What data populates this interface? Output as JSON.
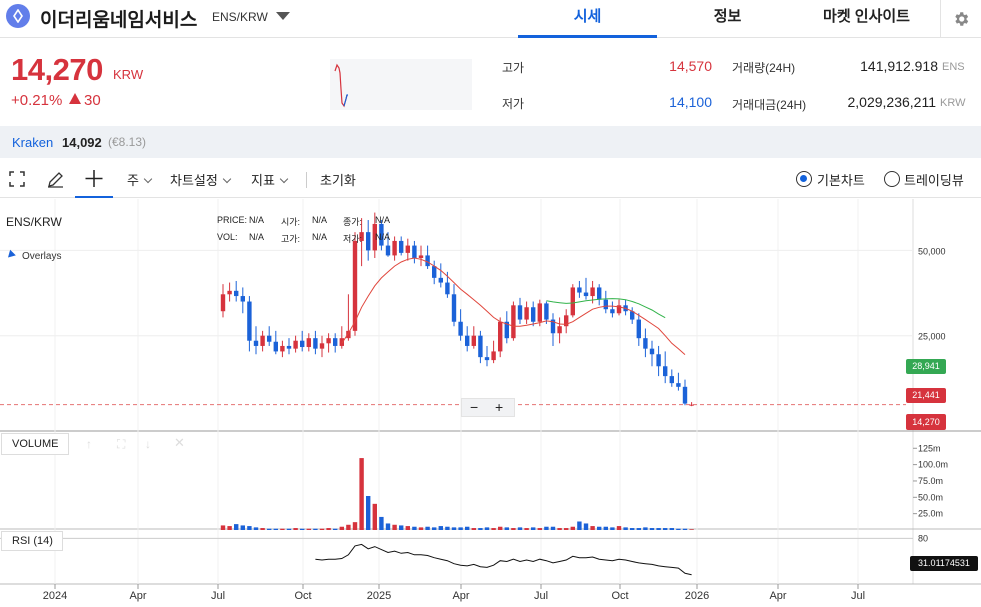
{
  "header": {
    "coin_name": "이더리움네임서비스",
    "pair": "ENS/KRW",
    "tabs": [
      "시세",
      "정보",
      "마켓 인사이트"
    ],
    "active_tab": "시세",
    "accent": "#1362dc"
  },
  "price": {
    "value": "14,270",
    "unit": "KRW",
    "change_pct": "+0.21%",
    "change_amount": "30",
    "direction": "up",
    "color": "#d6333d"
  },
  "stats": {
    "high_label": "고가",
    "high_value": "14,570",
    "low_label": "저가",
    "low_value": "14,100",
    "volume_label": "거래량(24H)",
    "volume_value": "141,912.918",
    "volume_unit": "ENS",
    "amount_label": "거래대금(24H)",
    "amount_value": "2,029,236,211",
    "amount_unit": "KRW"
  },
  "exchange": {
    "name": "Kraken",
    "price": "14,092",
    "fiat": "(€8.13)"
  },
  "toolbar": {
    "fullscreen_icon": "fullscreen-icon",
    "pencil_icon": "pencil-icon",
    "crosshair_icon": "crosshair-icon",
    "period_label": "주",
    "settings_label": "차트설정",
    "indicator_label": "지표",
    "reset_label": "초기화",
    "basic_chart_label": "기본차트",
    "tradingview_label": "트레이딩뷰",
    "selected_view": "기본차트"
  },
  "chart_panel": {
    "symbol": "ENS/KRW",
    "overlays_label": "Overlays",
    "ohlc_labels": {
      "price": "PRICE:",
      "open": "시가:",
      "close": "종가:",
      "vol": "VOL:",
      "high": "고가:",
      "low": "저가:"
    },
    "ohlc_value": "N/A",
    "zoom_out": "−",
    "zoom_in": "+",
    "volume_label": "VOLUME",
    "rsi_label": "RSI (14)",
    "y_ticks": [
      "50,000",
      "25,000"
    ],
    "vol_ticks": [
      "125m",
      "100.0m",
      "75.0m",
      "50.0m",
      "25.0m"
    ],
    "rsi_ticks": [
      "80"
    ],
    "x_ticks": [
      "2024",
      "Apr",
      "Jul",
      "Oct",
      "2025",
      "Apr",
      "Jul",
      "Oct",
      "2026",
      "Apr",
      "Jul"
    ],
    "price_tag": "14,270",
    "ma_long_tag": "28,941",
    "ma_short_tag": "21,441",
    "rsi_value": "31.01174531",
    "up_color": "#d6333d",
    "down_color": "#1b62d8",
    "ma_short_color": "#e0463c",
    "ma_long_color": "#32b34a"
  },
  "chart_data": {
    "type": "candlestick",
    "title": "ENS/KRW",
    "interval": "weekly",
    "x_start": "2024-07",
    "x_end": "2025-12",
    "candles": [
      {
        "o": 30500,
        "h": 38000,
        "l": 29000,
        "c": 35000
      },
      {
        "o": 35000,
        "h": 38500,
        "l": 33000,
        "c": 36000
      },
      {
        "o": 36000,
        "h": 39000,
        "l": 33000,
        "c": 34500
      },
      {
        "o": 34500,
        "h": 37000,
        "l": 30000,
        "c": 33000
      },
      {
        "o": 33000,
        "h": 34500,
        "l": 22000,
        "c": 24000
      },
      {
        "o": 24000,
        "h": 27000,
        "l": 21500,
        "c": 23000
      },
      {
        "o": 23000,
        "h": 26000,
        "l": 22000,
        "c": 25000
      },
      {
        "o": 25000,
        "h": 27000,
        "l": 23000,
        "c": 23800
      },
      {
        "o": 23800,
        "h": 26000,
        "l": 21500,
        "c": 22000
      },
      {
        "o": 22000,
        "h": 24000,
        "l": 21000,
        "c": 23000
      },
      {
        "o": 23000,
        "h": 24500,
        "l": 21500,
        "c": 22500
      },
      {
        "o": 22500,
        "h": 25000,
        "l": 21800,
        "c": 24000
      },
      {
        "o": 24000,
        "h": 26000,
        "l": 22000,
        "c": 22800
      },
      {
        "o": 22800,
        "h": 25500,
        "l": 22000,
        "c": 24500
      },
      {
        "o": 24500,
        "h": 26000,
        "l": 21500,
        "c": 22500
      },
      {
        "o": 22500,
        "h": 25000,
        "l": 21000,
        "c": 23500
      },
      {
        "o": 23500,
        "h": 25500,
        "l": 21800,
        "c": 24500
      },
      {
        "o": 24500,
        "h": 25500,
        "l": 21800,
        "c": 23000
      },
      {
        "o": 23000,
        "h": 27000,
        "l": 22500,
        "c": 24500
      },
      {
        "o": 24500,
        "h": 35000,
        "l": 24000,
        "c": 26000
      },
      {
        "o": 26000,
        "h": 58000,
        "l": 25000,
        "c": 54000
      },
      {
        "o": 54000,
        "h": 65000,
        "l": 44000,
        "c": 58000
      },
      {
        "o": 58000,
        "h": 64000,
        "l": 46000,
        "c": 50000
      },
      {
        "o": 50000,
        "h": 68000,
        "l": 47000,
        "c": 62000
      },
      {
        "o": 62000,
        "h": 64000,
        "l": 50000,
        "c": 52000
      },
      {
        "o": 52000,
        "h": 58000,
        "l": 47500,
        "c": 48000
      },
      {
        "o": 48000,
        "h": 56000,
        "l": 46000,
        "c": 54000
      },
      {
        "o": 54000,
        "h": 56000,
        "l": 48000,
        "c": 49000
      },
      {
        "o": 49000,
        "h": 55000,
        "l": 46000,
        "c": 52000
      },
      {
        "o": 52000,
        "h": 54000,
        "l": 45000,
        "c": 47000
      },
      {
        "o": 47000,
        "h": 52000,
        "l": 44000,
        "c": 48000
      },
      {
        "o": 48000,
        "h": 52000,
        "l": 43000,
        "c": 44000
      },
      {
        "o": 44000,
        "h": 46000,
        "l": 38000,
        "c": 40000
      },
      {
        "o": 40000,
        "h": 45000,
        "l": 37000,
        "c": 38500
      },
      {
        "o": 38500,
        "h": 42000,
        "l": 34000,
        "c": 35000
      },
      {
        "o": 35000,
        "h": 38000,
        "l": 27000,
        "c": 28000
      },
      {
        "o": 28000,
        "h": 31000,
        "l": 24000,
        "c": 25000
      },
      {
        "o": 25000,
        "h": 27000,
        "l": 22000,
        "c": 23000
      },
      {
        "o": 23000,
        "h": 27000,
        "l": 22500,
        "c": 25000
      },
      {
        "o": 25000,
        "h": 26000,
        "l": 20000,
        "c": 21000
      },
      {
        "o": 21000,
        "h": 23000,
        "l": 19500,
        "c": 20500
      },
      {
        "o": 20500,
        "h": 24000,
        "l": 20000,
        "c": 22000
      },
      {
        "o": 22000,
        "h": 29000,
        "l": 21000,
        "c": 28000
      },
      {
        "o": 28000,
        "h": 30500,
        "l": 23500,
        "c": 24500
      },
      {
        "o": 24500,
        "h": 33000,
        "l": 24000,
        "c": 32000
      },
      {
        "o": 32000,
        "h": 34000,
        "l": 27500,
        "c": 28500
      },
      {
        "o": 28500,
        "h": 33000,
        "l": 27500,
        "c": 31500
      },
      {
        "o": 31500,
        "h": 33000,
        "l": 27000,
        "c": 28000
      },
      {
        "o": 28000,
        "h": 33500,
        "l": 27000,
        "c": 32500
      },
      {
        "o": 32500,
        "h": 33000,
        "l": 27500,
        "c": 28500
      },
      {
        "o": 28500,
        "h": 30000,
        "l": 23000,
        "c": 25500
      },
      {
        "o": 25500,
        "h": 29000,
        "l": 23500,
        "c": 27000
      },
      {
        "o": 27000,
        "h": 31000,
        "l": 25500,
        "c": 29500
      },
      {
        "o": 29500,
        "h": 38000,
        "l": 29000,
        "c": 37000
      },
      {
        "o": 37000,
        "h": 39000,
        "l": 34000,
        "c": 35500
      },
      {
        "o": 35500,
        "h": 40000,
        "l": 33500,
        "c": 34500
      },
      {
        "o": 34500,
        "h": 39000,
        "l": 32500,
        "c": 37000
      },
      {
        "o": 37000,
        "h": 38000,
        "l": 32000,
        "c": 33500
      },
      {
        "o": 33500,
        "h": 36000,
        "l": 30000,
        "c": 31000
      },
      {
        "o": 31000,
        "h": 33000,
        "l": 29000,
        "c": 30000
      },
      {
        "o": 30000,
        "h": 33500,
        "l": 29500,
        "c": 32000
      },
      {
        "o": 32000,
        "h": 33500,
        "l": 29500,
        "c": 30500
      },
      {
        "o": 30500,
        "h": 31500,
        "l": 27500,
        "c": 28500
      },
      {
        "o": 28500,
        "h": 30000,
        "l": 23000,
        "c": 24500
      },
      {
        "o": 24500,
        "h": 26500,
        "l": 21000,
        "c": 22500
      },
      {
        "o": 22500,
        "h": 24000,
        "l": 19500,
        "c": 21500
      },
      {
        "o": 21500,
        "h": 23000,
        "l": 18000,
        "c": 19500
      },
      {
        "o": 19500,
        "h": 22000,
        "l": 17000,
        "c": 18000
      },
      {
        "o": 18000,
        "h": 19000,
        "l": 16500,
        "c": 17000
      },
      {
        "o": 17000,
        "h": 18500,
        "l": 16000,
        "c": 16500
      },
      {
        "o": 16500,
        "h": 17500,
        "l": 14200,
        "c": 14400
      },
      {
        "o": 14240,
        "h": 14570,
        "l": 14100,
        "c": 14270
      }
    ],
    "ma_short": [
      null,
      null,
      null,
      null,
      null,
      null,
      null,
      null,
      null,
      null,
      null,
      null,
      null,
      null,
      null,
      null,
      null,
      null,
      23500,
      25500,
      28000,
      31500,
      34500,
      37500,
      40000,
      42000,
      44000,
      45500,
      46500,
      47000,
      46500,
      45500,
      44000,
      42500,
      40500,
      38500,
      36500,
      35000,
      33500,
      32000,
      30500,
      29000,
      28000,
      27500,
      27000,
      27000,
      27200,
      27500,
      27800,
      28200,
      28000,
      27500,
      27400,
      28000,
      29000,
      30000,
      31000,
      31500,
      31800,
      31800,
      31600,
      31200,
      30500,
      29500,
      28500,
      27500,
      26500,
      25000,
      23500,
      22500,
      21441
    ],
    "ma_long": [
      null,
      null,
      null,
      null,
      null,
      null,
      null,
      null,
      null,
      null,
      null,
      null,
      null,
      null,
      null,
      null,
      null,
      null,
      null,
      null,
      null,
      null,
      null,
      null,
      null,
      null,
      null,
      null,
      null,
      null,
      null,
      null,
      null,
      null,
      null,
      null,
      null,
      null,
      null,
      null,
      null,
      null,
      null,
      null,
      null,
      null,
      null,
      null,
      null,
      33200,
      32900,
      32700,
      32500,
      32600,
      32900,
      33200,
      33400,
      33600,
      33700,
      33800,
      33700,
      33500,
      33000,
      32400,
      31600,
      30800,
      29800,
      28941
    ],
    "volume_m": [
      7,
      6,
      9,
      7,
      6,
      4,
      3,
      2,
      2,
      2,
      2,
      3,
      2,
      2,
      2,
      2,
      3,
      2,
      5,
      8,
      12,
      110,
      52,
      40,
      20,
      10,
      8,
      7,
      6,
      5,
      4,
      5,
      4,
      6,
      5,
      4,
      4,
      5,
      3,
      3,
      4,
      3,
      5,
      4,
      3,
      4,
      3,
      4,
      3,
      5,
      5,
      3,
      3,
      5,
      13,
      10,
      6,
      5,
      5,
      4,
      6,
      4,
      3,
      3,
      4,
      3,
      3,
      3,
      3,
      2,
      2,
      1
    ],
    "rsi": [
      null,
      null,
      null,
      null,
      null,
      null,
      null,
      null,
      null,
      null,
      null,
      null,
      null,
      null,
      52,
      51,
      52,
      52,
      53,
      58,
      70,
      72,
      66,
      69,
      65,
      61,
      63,
      60,
      61,
      58,
      58,
      57,
      54,
      52,
      50,
      46,
      44,
      43,
      45,
      42,
      41,
      44,
      50,
      49,
      52,
      49,
      51,
      49,
      52,
      50,
      47,
      49,
      51,
      56,
      54,
      54,
      55,
      52,
      51,
      50,
      52,
      51,
      49,
      47,
      46,
      45,
      43,
      42,
      41,
      40,
      33,
      31.01174531
    ],
    "y_range": [
      12000,
      70000
    ],
    "vol_range": [
      0,
      130
    ],
    "rsi_range": [
      20,
      90
    ]
  }
}
